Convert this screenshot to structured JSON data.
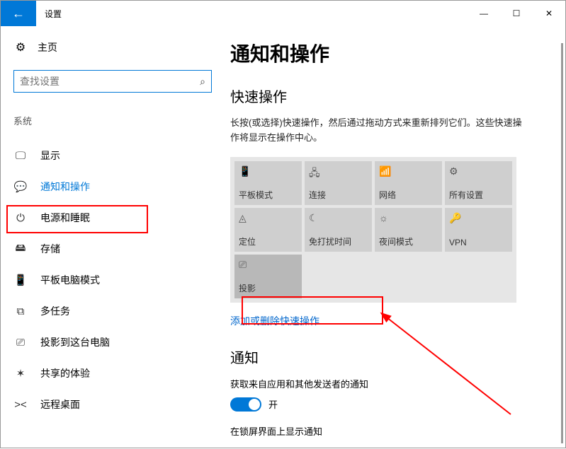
{
  "window": {
    "title": "设置",
    "controls": {
      "min": "—",
      "max": "☐",
      "close": "✕"
    }
  },
  "sidebar": {
    "home": "主页",
    "search_placeholder": "查找设置",
    "search_icon": "⌕",
    "category": "系统",
    "items": [
      {
        "icon": "🖵",
        "label": "显示",
        "active": false
      },
      {
        "icon": "💬",
        "label": "通知和操作",
        "active": true
      },
      {
        "icon": "⏻",
        "label": "电源和睡眠",
        "active": false
      },
      {
        "icon": "🖴",
        "label": "存储",
        "active": false
      },
      {
        "icon": "📱",
        "label": "平板电脑模式",
        "active": false
      },
      {
        "icon": "⧉",
        "label": "多任务",
        "active": false
      },
      {
        "icon": "⎚",
        "label": "投影到这台电脑",
        "active": false
      },
      {
        "icon": "✶",
        "label": "共享的体验",
        "active": false
      },
      {
        "icon": "><",
        "label": "远程桌面",
        "active": false
      }
    ]
  },
  "main": {
    "heading": "通知和操作",
    "quick_actions": {
      "title": "快速操作",
      "desc": "长按(或选择)快速操作，然后通过拖动方式来重新排列它们。这些快速操作将显示在操作中心。",
      "tiles": [
        {
          "icon": "📱",
          "label": "平板模式"
        },
        {
          "icon": "🖧",
          "label": "连接"
        },
        {
          "icon": "📶",
          "label": "网络"
        },
        {
          "icon": "⚙",
          "label": "所有设置"
        },
        {
          "icon": "◬",
          "label": "定位"
        },
        {
          "icon": "☾",
          "label": "免打扰时间"
        },
        {
          "icon": "☼",
          "label": "夜间模式"
        },
        {
          "icon": "🔑",
          "label": "VPN"
        },
        {
          "icon": "⎚",
          "label": "投影",
          "disabled": true
        }
      ],
      "link": "添加或删除快速操作"
    },
    "notifications": {
      "title": "通知",
      "desc1": "获取来自应用和其他发送者的通知",
      "toggle_state": "开",
      "desc2": "在锁屏界面上显示通知"
    }
  }
}
